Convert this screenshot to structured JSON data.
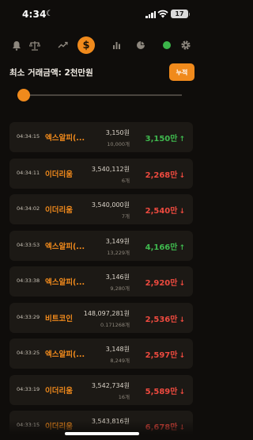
{
  "status": {
    "time": "4:34",
    "battery": "17"
  },
  "nav": {
    "icons": [
      "bell-icon",
      "scale-icon",
      "trend-icon",
      "dollar-icon",
      "bar-chart-icon",
      "pie-chart-icon",
      "status-dot-icon",
      "gear-icon"
    ],
    "dollar_symbol": "$",
    "accent": "#f08a1c",
    "online_color": "#3bb54a"
  },
  "filter": {
    "min_label": "최소 거래금액: 2천만원",
    "apply_label": "누적",
    "slider_level": 0.02
  },
  "colors": {
    "up": "#3fb94e",
    "down": "#ee4a3f",
    "row_bg": "#1c1915"
  },
  "trades": [
    {
      "time": "04:34:15",
      "coin": "엑스알피(...",
      "price": "3,150원",
      "qty": "10,000개",
      "amount": "3,150만",
      "dir": "up",
      "arrow": "↑"
    },
    {
      "time": "04:34:11",
      "coin": "이더리움",
      "price": "3,540,112원",
      "qty": "6개",
      "amount": "2,268만",
      "dir": "down",
      "arrow": "↓"
    },
    {
      "time": "04:34:02",
      "coin": "이더리움",
      "price": "3,540,000원",
      "qty": "7개",
      "amount": "2,540만",
      "dir": "down",
      "arrow": "↓"
    },
    {
      "time": "04:33:53",
      "coin": "엑스알피(...",
      "price": "3,149원",
      "qty": "13,229개",
      "amount": "4,166만",
      "dir": "up",
      "arrow": "↑"
    },
    {
      "time": "04:33:38",
      "coin": "엑스알피(...",
      "price": "3,146원",
      "qty": "9,280개",
      "amount": "2,920만",
      "dir": "down",
      "arrow": "↓"
    },
    {
      "time": "04:33:29",
      "coin": "비트코인",
      "price": "148,097,281원",
      "qty": "0.17126­8개",
      "amount": "2,536만",
      "dir": "down",
      "arrow": "↓"
    },
    {
      "time": "04:33:25",
      "coin": "엑스알피(...",
      "price": "3,148원",
      "qty": "8,249개",
      "amount": "2,597만",
      "dir": "down",
      "arrow": "↓"
    },
    {
      "time": "04:33:19",
      "coin": "이더리움",
      "price": "3,542,734원",
      "qty": "16개",
      "amount": "5,589만",
      "dir": "down",
      "arrow": "↓"
    },
    {
      "time": "04:33:15",
      "coin": "이더리움",
      "price": "3,543,816원",
      "qty": "",
      "amount": "6,678만",
      "dir": "down",
      "arrow": "↓"
    }
  ]
}
